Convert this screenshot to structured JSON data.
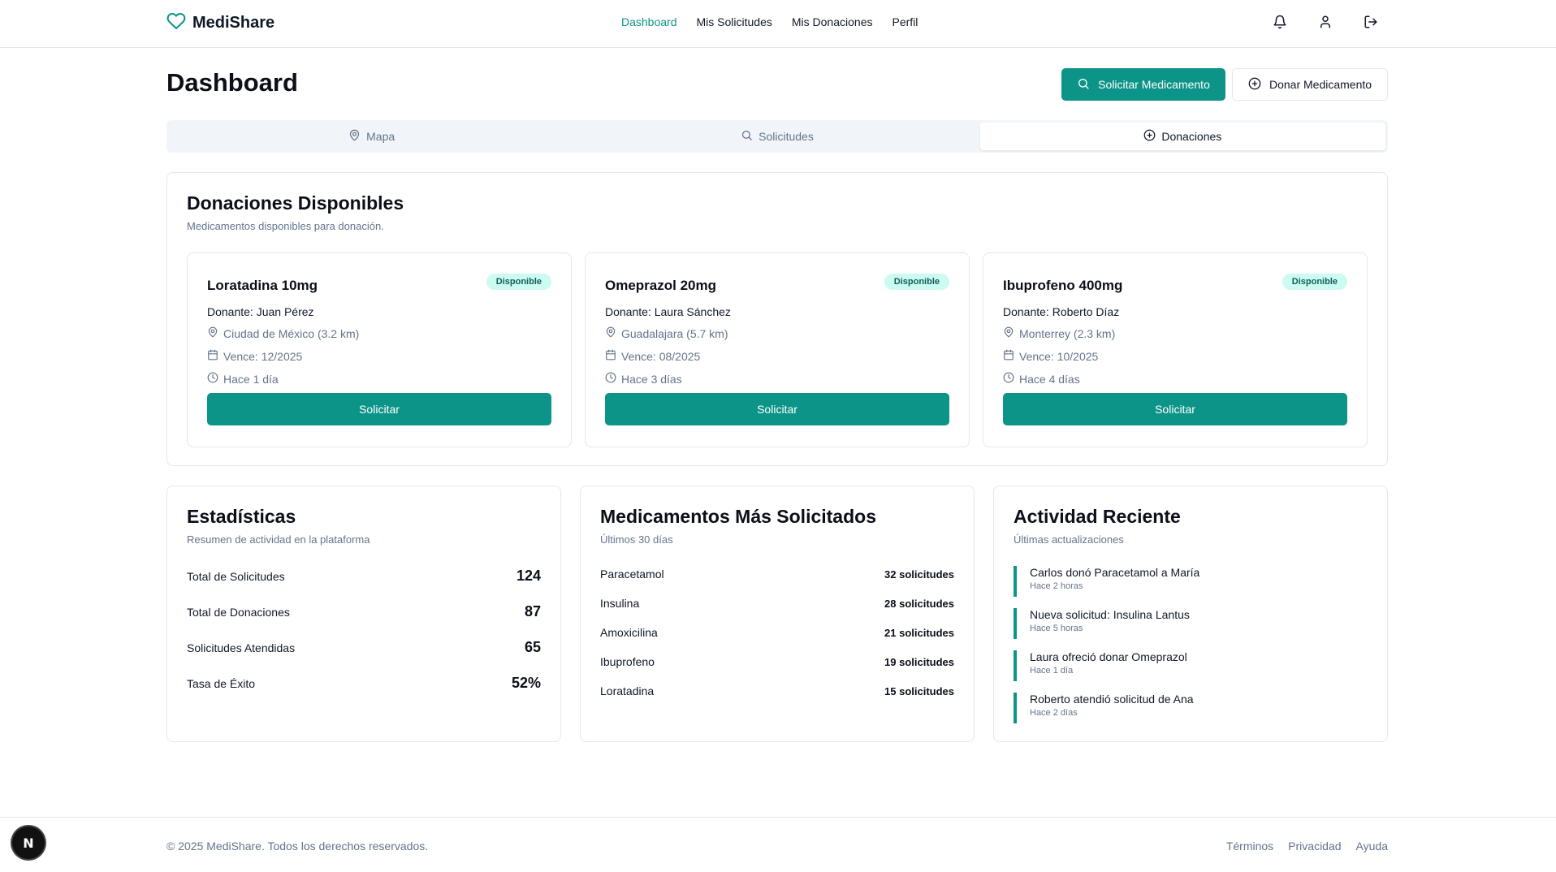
{
  "brand": {
    "name": "MediShare",
    "accent": "#0d9488"
  },
  "nav": [
    "Dashboard",
    "Mis Solicitudes",
    "Mis Donaciones",
    "Perfil"
  ],
  "header_icons": [
    "bell-icon",
    "user-icon",
    "logout-icon"
  ],
  "page": {
    "title": "Dashboard",
    "primary_button": "Solicitar Medicamento",
    "secondary_button": "Donar Medicamento"
  },
  "tabs": [
    "Mapa",
    "Solicitudes",
    "Donaciones"
  ],
  "donations": {
    "title": "Donaciones Disponibles",
    "subtitle": "Medicamentos disponibles para donación.",
    "items": [
      {
        "name": "Loratadina 10mg",
        "badge": "Disponible",
        "donor": "Donante: Juan Pérez",
        "location": "Ciudad de México (3.2 km)",
        "expires": "Vence: 12/2025",
        "time": "Hace 1 día",
        "button": "Solicitar"
      },
      {
        "name": "Omeprazol 20mg",
        "badge": "Disponible",
        "donor": "Donante: Laura Sánchez",
        "location": "Guadalajara (5.7 km)",
        "expires": "Vence: 08/2025",
        "time": "Hace 3 días",
        "button": "Solicitar"
      },
      {
        "name": "Ibuprofeno 400mg",
        "badge": "Disponible",
        "donor": "Donante: Roberto Díaz",
        "location": "Monterrey (2.3 km)",
        "expires": "Vence: 10/2025",
        "time": "Hace 4 días",
        "button": "Solicitar"
      }
    ]
  },
  "stats": {
    "title": "Estadísticas",
    "subtitle": "Resumen de actividad en la plataforma",
    "rows": [
      {
        "label": "Total de Solicitudes",
        "value": "124"
      },
      {
        "label": "Total de Donaciones",
        "value": "87"
      },
      {
        "label": "Solicitudes Atendidas",
        "value": "65"
      },
      {
        "label": "Tasa de Éxito",
        "value": "52%"
      }
    ]
  },
  "top_meds": {
    "title": "Medicamentos Más Solicitados",
    "subtitle": "Últimos 30 días",
    "rows": [
      {
        "name": "Paracetamol",
        "count": "32 solicitudes"
      },
      {
        "name": "Insulina",
        "count": "28 solicitudes"
      },
      {
        "name": "Amoxicilina",
        "count": "21 solicitudes"
      },
      {
        "name": "Ibuprofeno",
        "count": "19 solicitudes"
      },
      {
        "name": "Loratadina",
        "count": "15 solicitudes"
      }
    ]
  },
  "activity": {
    "title": "Actividad Reciente",
    "subtitle": "Últimas actualizaciones",
    "items": [
      {
        "text": "Carlos donó Paracetamol a María",
        "time": "Hace 2 horas"
      },
      {
        "text": "Nueva solicitud: Insulina Lantus",
        "time": "Hace 5 horas"
      },
      {
        "text": "Laura ofreció donar Omeprazol",
        "time": "Hace 1 día"
      },
      {
        "text": "Roberto atendió solicitud de Ana",
        "time": "Hace 2 días"
      }
    ]
  },
  "footer": {
    "copyright": "© 2025 MediShare. Todos los derechos reservados.",
    "links": [
      "Términos",
      "Privacidad",
      "Ayuda"
    ]
  },
  "dev_badge": "N"
}
